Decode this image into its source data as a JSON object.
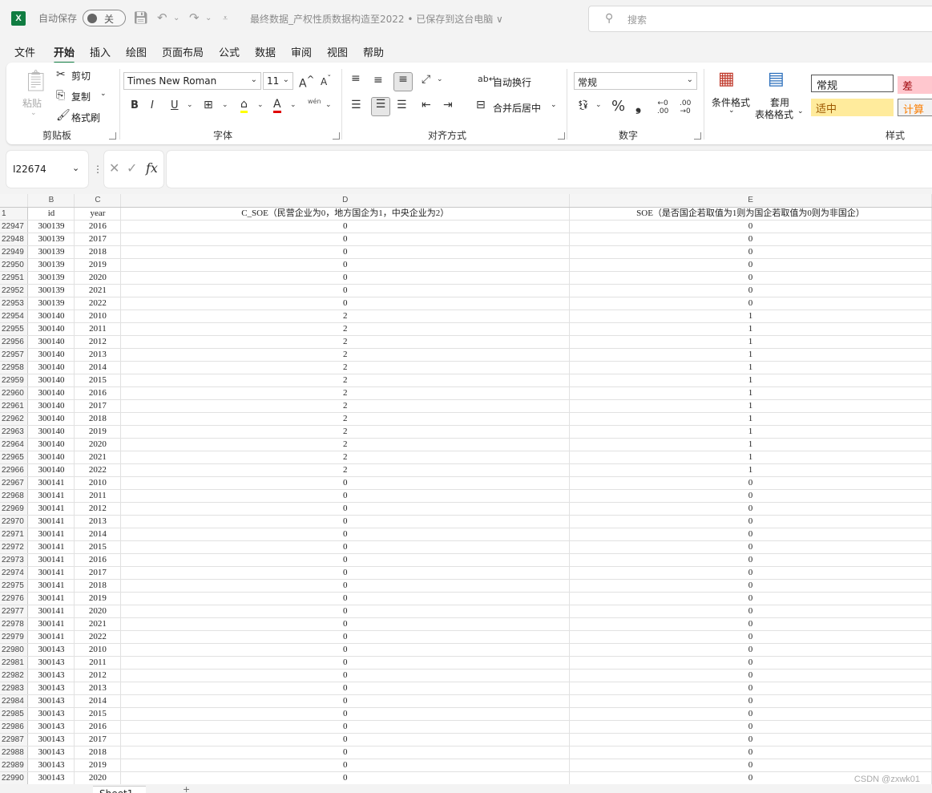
{
  "titlebar": {
    "app_icon": "X",
    "autosave_label": "自动保存",
    "autosave_state": "关",
    "document_title": "最终数据_产权性质数据构造至2022 • 已保存到这台电脑 ∨",
    "search_placeholder": "搜索"
  },
  "tabs": [
    "文件",
    "开始",
    "插入",
    "绘图",
    "页面布局",
    "公式",
    "数据",
    "审阅",
    "视图",
    "帮助"
  ],
  "ribbon": {
    "clipboard": {
      "paste": "粘贴",
      "cut": "剪切",
      "copy": "复制",
      "format_painter": "格式刷",
      "label": "剪贴板"
    },
    "font": {
      "name": "Times New Roman",
      "size": "11",
      "label": "字体",
      "wen": "wén"
    },
    "alignment": {
      "wrap": "自动换行",
      "merge": "合并后居中",
      "label": "对齐方式"
    },
    "number": {
      "format": "常规",
      "label": "数字"
    },
    "styles": {
      "conditional": "条件格式",
      "table_format_line1": "套用",
      "table_format_line2": "表格格式",
      "normal": "常规",
      "bad": "差",
      "neutral": "适中",
      "calc": "计算",
      "label": "样式"
    }
  },
  "namebox": "I22674",
  "formula": "",
  "grid": {
    "col_letters": [
      "B",
      "C",
      "D",
      "E"
    ],
    "header_row_num": "1",
    "headers": [
      "id",
      "year",
      "C_SOE（民营企业为0，地方国企为1，中央企业为2）",
      "SOE（是否国企若取值为1则为国企若取值为0则为非国企）"
    ],
    "rows": [
      [
        "22947",
        "300139",
        "2016",
        "0",
        "0"
      ],
      [
        "22948",
        "300139",
        "2017",
        "0",
        "0"
      ],
      [
        "22949",
        "300139",
        "2018",
        "0",
        "0"
      ],
      [
        "22950",
        "300139",
        "2019",
        "0",
        "0"
      ],
      [
        "22951",
        "300139",
        "2020",
        "0",
        "0"
      ],
      [
        "22952",
        "300139",
        "2021",
        "0",
        "0"
      ],
      [
        "22953",
        "300139",
        "2022",
        "0",
        "0"
      ],
      [
        "22954",
        "300140",
        "2010",
        "2",
        "1"
      ],
      [
        "22955",
        "300140",
        "2011",
        "2",
        "1"
      ],
      [
        "22956",
        "300140",
        "2012",
        "2",
        "1"
      ],
      [
        "22957",
        "300140",
        "2013",
        "2",
        "1"
      ],
      [
        "22958",
        "300140",
        "2014",
        "2",
        "1"
      ],
      [
        "22959",
        "300140",
        "2015",
        "2",
        "1"
      ],
      [
        "22960",
        "300140",
        "2016",
        "2",
        "1"
      ],
      [
        "22961",
        "300140",
        "2017",
        "2",
        "1"
      ],
      [
        "22962",
        "300140",
        "2018",
        "2",
        "1"
      ],
      [
        "22963",
        "300140",
        "2019",
        "2",
        "1"
      ],
      [
        "22964",
        "300140",
        "2020",
        "2",
        "1"
      ],
      [
        "22965",
        "300140",
        "2021",
        "2",
        "1"
      ],
      [
        "22966",
        "300140",
        "2022",
        "2",
        "1"
      ],
      [
        "22967",
        "300141",
        "2010",
        "0",
        "0"
      ],
      [
        "22968",
        "300141",
        "2011",
        "0",
        "0"
      ],
      [
        "22969",
        "300141",
        "2012",
        "0",
        "0"
      ],
      [
        "22970",
        "300141",
        "2013",
        "0",
        "0"
      ],
      [
        "22971",
        "300141",
        "2014",
        "0",
        "0"
      ],
      [
        "22972",
        "300141",
        "2015",
        "0",
        "0"
      ],
      [
        "22973",
        "300141",
        "2016",
        "0",
        "0"
      ],
      [
        "22974",
        "300141",
        "2017",
        "0",
        "0"
      ],
      [
        "22975",
        "300141",
        "2018",
        "0",
        "0"
      ],
      [
        "22976",
        "300141",
        "2019",
        "0",
        "0"
      ],
      [
        "22977",
        "300141",
        "2020",
        "0",
        "0"
      ],
      [
        "22978",
        "300141",
        "2021",
        "0",
        "0"
      ],
      [
        "22979",
        "300141",
        "2022",
        "0",
        "0"
      ],
      [
        "22980",
        "300143",
        "2010",
        "0",
        "0"
      ],
      [
        "22981",
        "300143",
        "2011",
        "0",
        "0"
      ],
      [
        "22982",
        "300143",
        "2012",
        "0",
        "0"
      ],
      [
        "22983",
        "300143",
        "2013",
        "0",
        "0"
      ],
      [
        "22984",
        "300143",
        "2014",
        "0",
        "0"
      ],
      [
        "22985",
        "300143",
        "2015",
        "0",
        "0"
      ],
      [
        "22986",
        "300143",
        "2016",
        "0",
        "0"
      ],
      [
        "22987",
        "300143",
        "2017",
        "0",
        "0"
      ],
      [
        "22988",
        "300143",
        "2018",
        "0",
        "0"
      ],
      [
        "22989",
        "300143",
        "2019",
        "0",
        "0"
      ],
      [
        "22990",
        "300143",
        "2020",
        "0",
        "0"
      ]
    ]
  },
  "sheet_tab": "Sheet1",
  "watermark": "CSDN @zxwk01",
  "colors": {
    "accent": "#107c41",
    "bad_bg": "#ffc7ce",
    "bad_fg": "#9c0006",
    "neutral_bg": "#ffeb9c",
    "neutral_fg": "#9c5700",
    "calc_bg": "#f2f2f2",
    "calc_fg": "#fa7d00"
  }
}
